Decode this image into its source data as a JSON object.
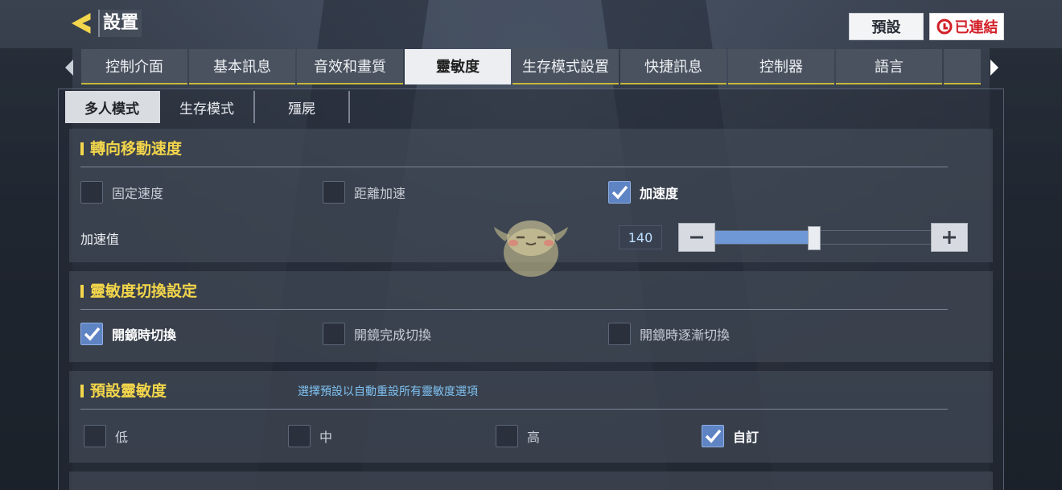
{
  "header": {
    "title": "設置",
    "back_icon": "back-arrow-icon",
    "preset_label": "預設",
    "connect_label": "已連結",
    "connect_icon": "garena-logo-icon",
    "accent_color": "#f3d64b"
  },
  "tabs": [
    {
      "label": "控制介面",
      "active": false
    },
    {
      "label": "基本訊息",
      "active": false
    },
    {
      "label": "音效和畫質",
      "active": false
    },
    {
      "label": "靈敏度",
      "active": true
    },
    {
      "label": "生存模式設置",
      "active": false
    },
    {
      "label": "快捷訊息",
      "active": false
    },
    {
      "label": "控制器",
      "active": false
    },
    {
      "label": "語言",
      "active": false
    }
  ],
  "subtabs": [
    {
      "label": "多人模式",
      "active": true
    },
    {
      "label": "生存模式",
      "active": false
    },
    {
      "label": "殭屍",
      "active": false
    }
  ],
  "turn_speed": {
    "title": "轉向移動速度",
    "options": [
      {
        "label": "固定速度",
        "checked": false
      },
      {
        "label": "距離加速",
        "checked": false
      },
      {
        "label": "加速度",
        "checked": true
      }
    ],
    "slider_label": "加速值",
    "slider_value": "140",
    "slider_level": 0.46
  },
  "switch_settings": {
    "title": "靈敏度切換設定",
    "options": [
      {
        "label": "開鏡時切換",
        "checked": true
      },
      {
        "label": "開鏡完成切換",
        "checked": false
      },
      {
        "label": "開鏡時逐漸切換",
        "checked": false
      }
    ]
  },
  "preset_sensitivity": {
    "title": "預設靈敏度",
    "hint": "選擇預設以自動重設所有靈敏度選項",
    "options": [
      {
        "label": "低",
        "checked": false
      },
      {
        "label": "中",
        "checked": false
      },
      {
        "label": "高",
        "checked": false
      },
      {
        "label": "自訂",
        "checked": true
      }
    ]
  }
}
